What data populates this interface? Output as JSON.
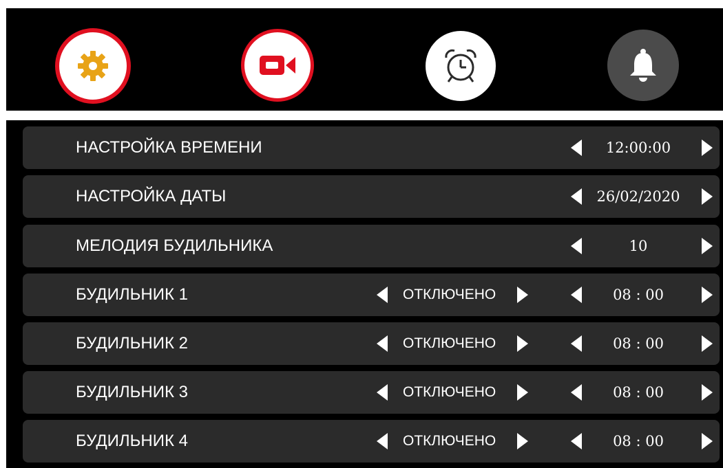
{
  "tabs": [
    {
      "name": "settings",
      "icon": "gear-icon",
      "icon_color": "#e8a317",
      "active": true
    },
    {
      "name": "video",
      "icon": "video-camera-icon",
      "icon_color": "#e01020"
    },
    {
      "name": "alarm",
      "icon": "alarm-clock-icon",
      "icon_color": "#2b2b2b"
    },
    {
      "name": "bell",
      "icon": "bell-icon",
      "icon_color": "#ffffff"
    }
  ],
  "rows": [
    {
      "label": "НАСТРОЙКА ВРЕМЕНИ",
      "value": "12:00:00"
    },
    {
      "label": "НАСТРОЙКА ДАТЫ",
      "value": "26/02/2020"
    },
    {
      "label": "МЕЛОДИЯ БУДИЛЬНИКА",
      "value": "10"
    },
    {
      "label": "БУДИЛЬНИК 1",
      "status": "ОТКЛЮЧЕНО",
      "value": "08 : 00"
    },
    {
      "label": "БУДИЛЬНИК 2",
      "status": "ОТКЛЮЧЕНО",
      "value": "08 : 00"
    },
    {
      "label": "БУДИЛЬНИК 3",
      "status": "ОТКЛЮЧЕНО",
      "value": "08 : 00"
    },
    {
      "label": "БУДИЛЬНИК 4",
      "status": "ОТКЛЮЧЕНО",
      "value": "08 : 00"
    }
  ]
}
